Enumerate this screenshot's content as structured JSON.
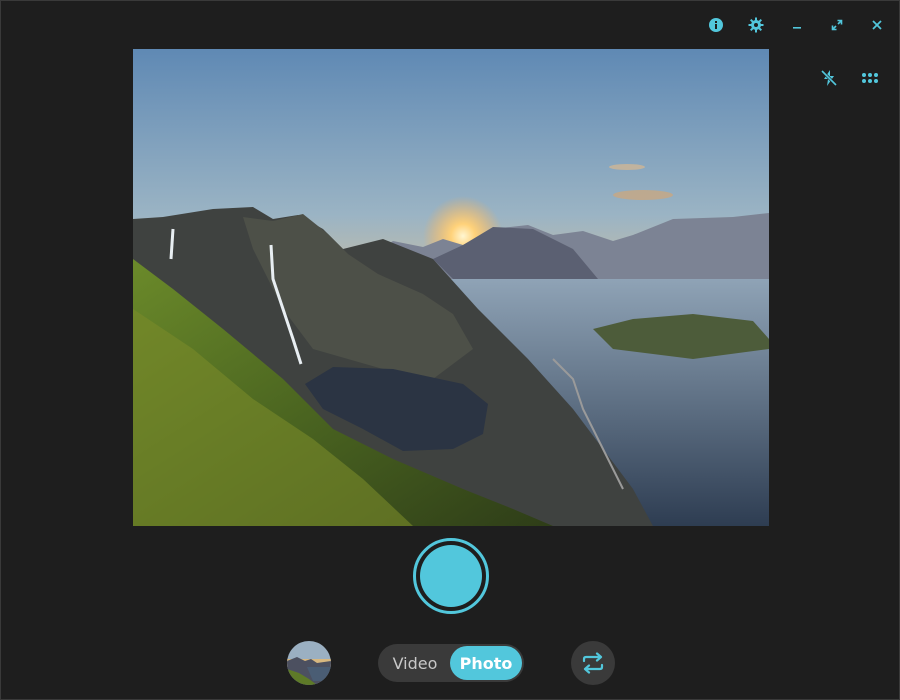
{
  "colors": {
    "accent": "#52c7dc",
    "background": "#1e1e1e",
    "control_bg": "#3a3a3a"
  },
  "titlebar": {
    "icons": [
      "info-icon",
      "gear-icon",
      "minimize-icon",
      "maximize-icon",
      "close-icon"
    ]
  },
  "viewfinder": {
    "content": "landscape-photo"
  },
  "side_controls": {
    "icons": [
      "flash-off-icon",
      "grid-icon"
    ]
  },
  "bottom": {
    "mode_video_label": "Video",
    "mode_photo_label": "Photo",
    "selected_mode": "Photo",
    "icons": [
      "gallery-thumbnail",
      "shutter-button",
      "switch-camera-icon"
    ]
  }
}
